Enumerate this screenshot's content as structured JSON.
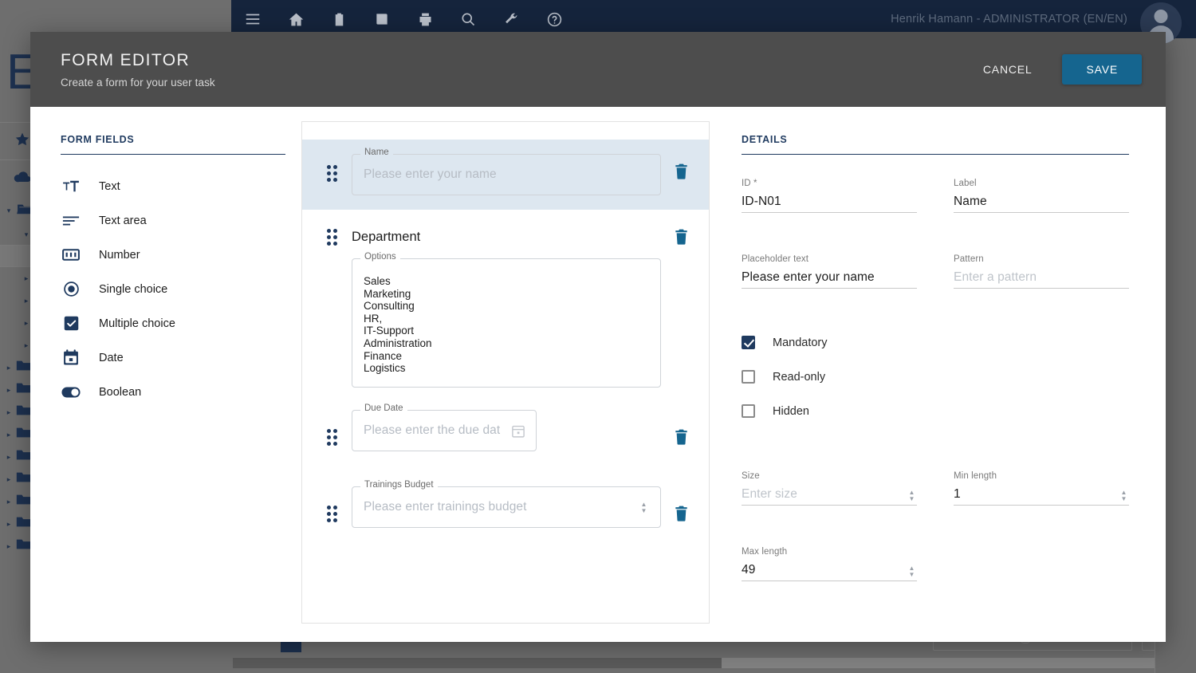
{
  "background": {
    "toolbar_icons": [
      "menu-icon",
      "home-icon",
      "clipboard-icon",
      "book-icon",
      "print-icon",
      "search-icon",
      "wrench-icon",
      "help-icon"
    ],
    "user_label": "Henrik Hamann - ADMINISTRATOR (EN/EN)",
    "big_letter": "E"
  },
  "modal": {
    "title": "FORM EDITOR",
    "subtitle": "Create a form for your user task",
    "cancel_label": "CANCEL",
    "save_label": "SAVE",
    "accent_color": "#15658f",
    "header_bg": "#4d4d4d"
  },
  "palette": {
    "title": "FORM FIELDS",
    "items": [
      {
        "label": "Text",
        "icon": "text-format-icon"
      },
      {
        "label": "Text area",
        "icon": "text-area-icon"
      },
      {
        "label": "Number",
        "icon": "number-icon"
      },
      {
        "label": "Single choice",
        "icon": "radio-button-icon"
      },
      {
        "label": "Multiple choice",
        "icon": "checkbox-icon"
      },
      {
        "label": "Date",
        "icon": "calendar-icon"
      },
      {
        "label": "Boolean",
        "icon": "toggle-icon"
      }
    ]
  },
  "canvas": {
    "fields": [
      {
        "type": "text",
        "label": "Name",
        "placeholder": "Please enter your name",
        "selected": true,
        "delete_icon": "trash-icon",
        "drag_icon": "drag-handle-icon"
      },
      {
        "type": "single-choice",
        "heading": "Department",
        "options_legend": "Options",
        "options": [
          "Sales",
          "Marketing",
          "Consulting",
          "HR,",
          "IT-Support",
          "Administration",
          "Finance",
          "Logistics"
        ],
        "selected": false,
        "delete_icon": "trash-icon",
        "drag_icon": "drag-handle-icon"
      },
      {
        "type": "date",
        "label": "Due Date",
        "placeholder": "Please enter the due dat",
        "selected": false,
        "field_icon": "calendar-icon",
        "delete_icon": "trash-icon",
        "drag_icon": "drag-handle-icon"
      },
      {
        "type": "number",
        "label": "Trainings Budget",
        "placeholder": "Please enter trainings budget",
        "selected": false,
        "field_icon": "number-spinner-icon",
        "delete_icon": "trash-icon",
        "drag_icon": "drag-handle-icon"
      }
    ]
  },
  "details": {
    "title": "DETAILS",
    "id": {
      "label": "ID *",
      "value": "ID-N01"
    },
    "label_field": {
      "label": "Label",
      "value": "Name"
    },
    "placeholder_field": {
      "label": "Placeholder text",
      "value": "Please enter your name"
    },
    "pattern": {
      "label": "Pattern",
      "value": "Enter a pattern",
      "is_placeholder": true
    },
    "checkboxes": [
      {
        "label": "Mandatory",
        "checked": true
      },
      {
        "label": "Read-only",
        "checked": false
      },
      {
        "label": "Hidden",
        "checked": false
      }
    ],
    "size": {
      "label": "Size",
      "value": "Enter size",
      "is_placeholder": true
    },
    "min_length": {
      "label": "Min length",
      "value": "1"
    },
    "max_length": {
      "label": "Max length",
      "value": "49"
    }
  }
}
